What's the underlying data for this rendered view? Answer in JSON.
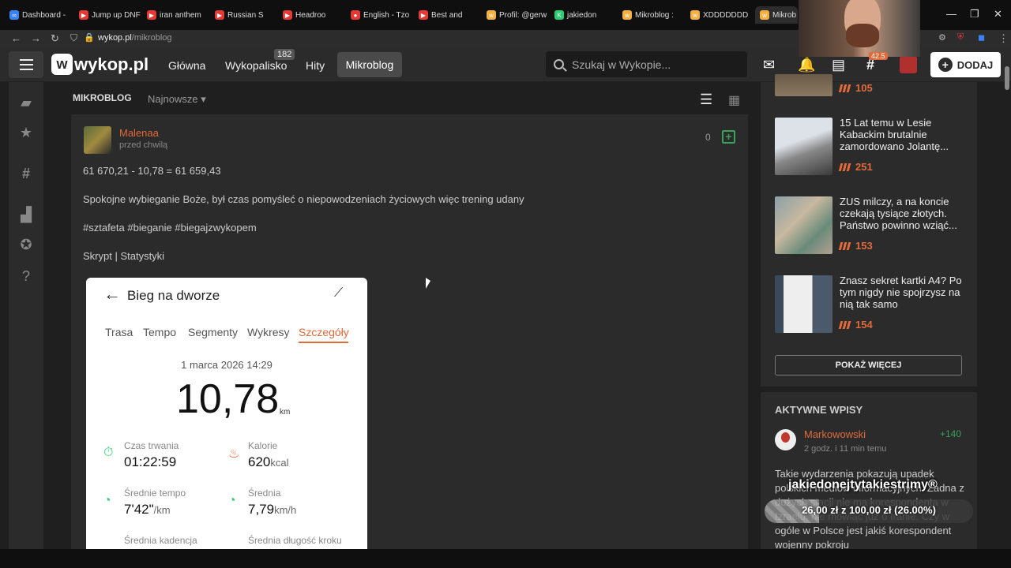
{
  "browser": {
    "tabs": [
      {
        "label": "Dashboard -",
        "color": "#3b82f6"
      },
      {
        "label": "Jump up DNF",
        "color": "#e53935"
      },
      {
        "label": "iran anthem",
        "color": "#e53935"
      },
      {
        "label": "Russian S",
        "color": "#e53935"
      },
      {
        "label": "Headroo",
        "color": "#e53935"
      },
      {
        "label": "English - Tzo",
        "color": "#e53935"
      },
      {
        "label": "Best and",
        "color": "#e53935"
      },
      {
        "label": "Profil: @gerw",
        "color": "#f5b041"
      },
      {
        "label": "jakiedon",
        "color": "#2ecc71"
      },
      {
        "label": "Mikroblog :",
        "color": "#f5b041"
      },
      {
        "label": "XDDDDDDD",
        "color": "#f5b041"
      },
      {
        "label": "Mikrob",
        "color": "#f5b041"
      }
    ],
    "url_host": "wykop.pl",
    "url_path": "/mikroblog"
  },
  "header": {
    "logo": "wykop.pl",
    "nav": [
      "Główna",
      "Wykopalisko",
      "Hity",
      "Mikroblog"
    ],
    "wykopalisko_badge": "182",
    "search_placeholder": "Szukaj w Wykopie...",
    "add_button": "DODAJ",
    "icon_badge": "42.5"
  },
  "main": {
    "section_title": "MIKROBLOG",
    "sort_label": "Najnowsze"
  },
  "post": {
    "author": "Malenaa",
    "time": "przed chwilą",
    "votes": "0",
    "line1": "61 670,21 - 10,78 = 61 659,43",
    "line2": "Spokojne wybieganie Boże, był czas pomyśleć o niepowodzeniach życiowych więc trening udany",
    "tags": "#sztafeta #bieganie #biegajzwykopem",
    "links": "Skrypt | Statystyki"
  },
  "phone": {
    "title": "Bieg na dworze",
    "tabs": [
      "Trasa",
      "Tempo",
      "Segmenty",
      "Wykresy",
      "Szczegóły"
    ],
    "date": "1 marca 2026 14:29",
    "distance": "10,78",
    "distance_unit": "km",
    "stats": {
      "duration_label": "Czas trwania",
      "duration_value": "01:22:59",
      "calories_label": "Kalorie",
      "calories_value": "620",
      "calories_unit": "kcal",
      "pace_label": "Średnie tempo",
      "pace_value": "7'42\"",
      "pace_unit": "/km",
      "speed_label": "Średnia",
      "speed_value": "7,79",
      "speed_unit": "km/h",
      "cadence_label": "Średnia kadencja",
      "stride_label": "Średnia długość kroku"
    }
  },
  "right": {
    "items": [
      {
        "title": "",
        "count": "105"
      },
      {
        "title": "15 Lat temu w Lesie Kabackim brutalnie zamordowano Jolantę...",
        "count": "251"
      },
      {
        "title": "ZUS milczy, a na koncie czekają tysiące złotych. Państwo powinno wziąć...",
        "count": "153"
      },
      {
        "title": "Znasz sekret kartki A4? Po tym nigdy nie spojrzysz na nią tak samo",
        "count": "154"
      }
    ],
    "more_button": "POKAŻ WIĘCEJ",
    "active_title": "AKTYWNE WPISY",
    "active_author": "Markowowski",
    "active_plus": "+140",
    "active_time": "2 godz. i 11 min temu",
    "active_text": "Takie wydarzenia pokazują upadek polskich mediów informacyjnych. Żadna z dużych stacji nie ma korespondenta w Izraelu, nie mówiąc już o Iranie. Czy w ogóle w Polsce jest jakiś korespondent wojenny pokroju"
  },
  "overlay": {
    "donate_title": "jakiedonejtytakiestrimy®",
    "donate_text": "26,00 zł z 100,00 zł (26.00%)",
    "donate_fraction": 0.26
  }
}
